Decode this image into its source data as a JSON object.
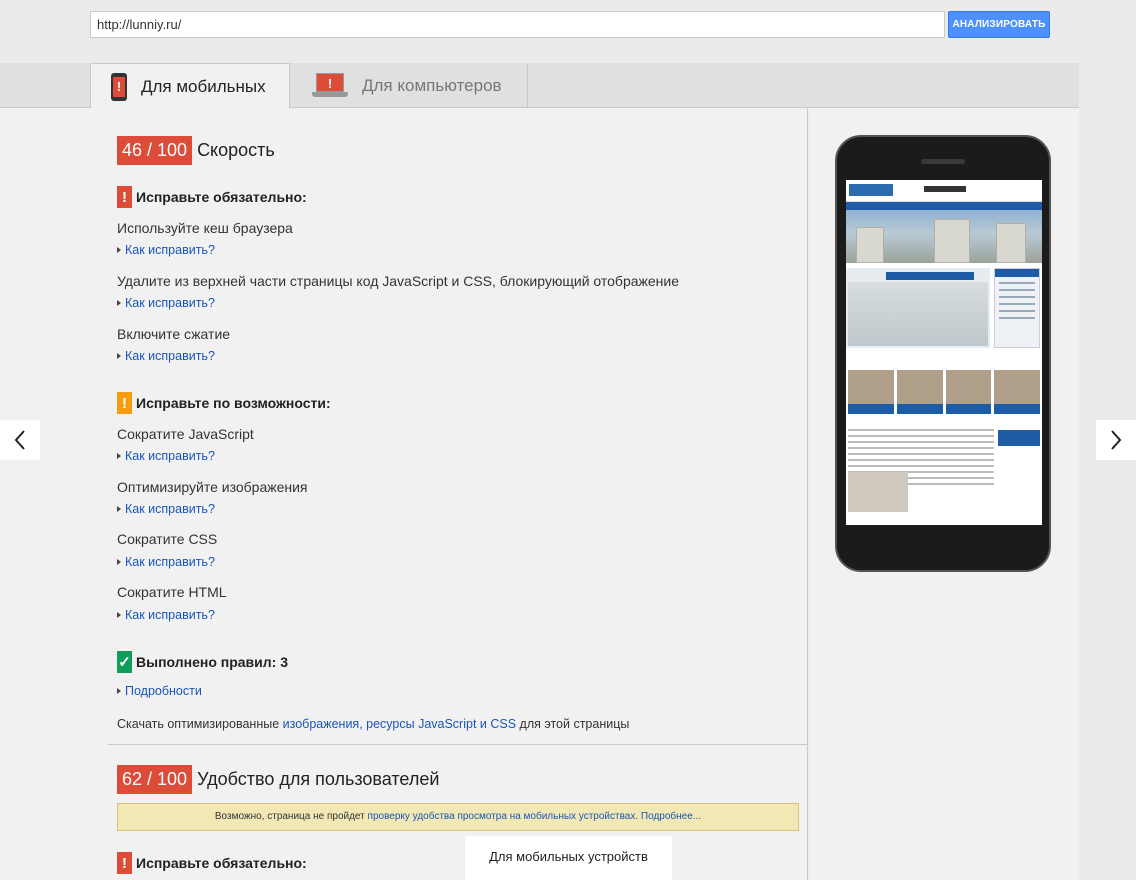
{
  "url_bar": {
    "value": "http://lunniy.ru/",
    "analyze_label": "АНАЛИЗИРОВАТЬ"
  },
  "tabs": [
    {
      "label": "Для мобильных",
      "icon": "mobile-phone-warning-icon",
      "active": true
    },
    {
      "label": "Для компьютеров",
      "icon": "desktop-monitor-warning-icon",
      "active": false
    }
  ],
  "speed": {
    "score": "46 / 100",
    "title": "Скорость",
    "must_fix_title": "Исправьте обязательно:",
    "must_fix": [
      {
        "text": "Используйте кеш браузера",
        "link": "Как исправить?"
      },
      {
        "text": "Удалите из верхней части страницы код JavaScript и CSS, блокирующий отображение",
        "link": "Как исправить?"
      },
      {
        "text": "Включите сжатие",
        "link": "Как исправить?"
      }
    ],
    "consider_title": "Исправьте по возможности:",
    "consider": [
      {
        "text": "Сократите JavaScript",
        "link": "Как исправить?"
      },
      {
        "text": "Оптимизируйте изображения",
        "link": "Как исправить?"
      },
      {
        "text": "Сократите CSS",
        "link": "Как исправить?"
      },
      {
        "text": "Сократите HTML",
        "link": "Как исправить?"
      }
    ],
    "passed_title": "Выполнено правил: 3",
    "passed_link": "Подробности",
    "download_prefix": "Скачать оптимизированные ",
    "download_link": "изображения, ресурсы JavaScript и CSS",
    "download_suffix": " для этой страницы"
  },
  "usability": {
    "score": "62 / 100",
    "title": "Удобство для пользователей",
    "warning_prefix": "Возможно, страница не пройдет ",
    "warning_link": "проверку удобства просмотра на мобильных устройствах",
    "warning_more": ". Подробнее...",
    "must_fix_title": "Исправьте обязательно:"
  },
  "tooltip": "Для мобильных устройств",
  "colors": {
    "red": "#dd4b39",
    "orange": "#f59d0d",
    "green": "#109d59",
    "link": "#1a55b8",
    "button": "#4d90fe"
  }
}
